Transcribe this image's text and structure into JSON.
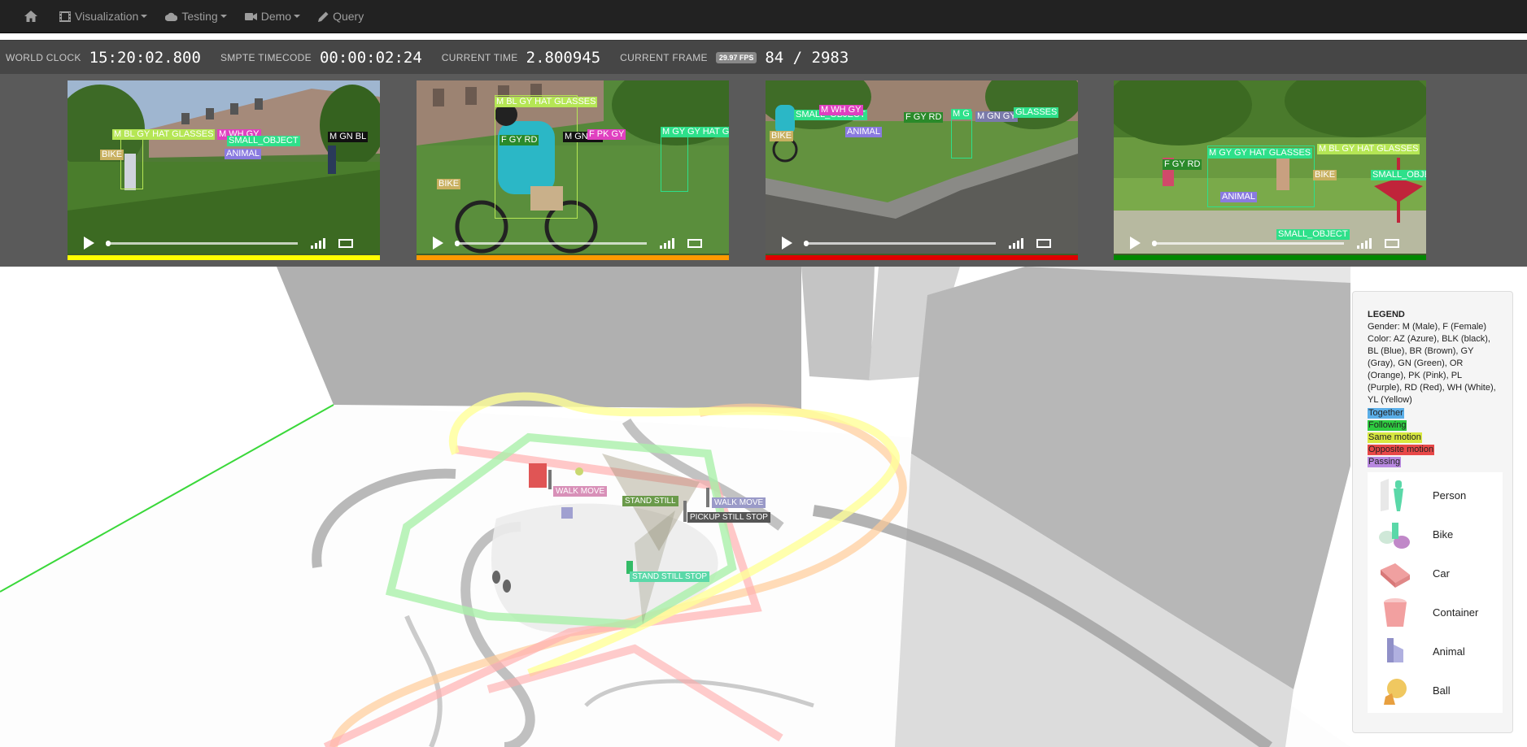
{
  "navbar": {
    "items": [
      {
        "label": "",
        "icon": "home-icon"
      },
      {
        "label": "Visualization",
        "icon": "film-icon",
        "dropdown": true
      },
      {
        "label": "Testing",
        "icon": "cloud-icon",
        "dropdown": true
      },
      {
        "label": "Demo",
        "icon": "video-camera-icon",
        "dropdown": true
      },
      {
        "label": "Query",
        "icon": "pencil-icon",
        "dropdown": false
      }
    ]
  },
  "clock": {
    "world_clock_label": "WORLD CLOCK",
    "world_clock_value": "15:20:02.800",
    "smpte_label": "SMPTE TIMECODE",
    "smpte_value": "00:00:02:24",
    "current_time_label": "CURRENT TIME",
    "current_time_value": "2.800945",
    "current_frame_label": "CURRENT FRAME",
    "fps_badge": "29.97 FPS",
    "current_frame_value": "84 / 2983"
  },
  "videos": [
    {
      "accent": "#ffff00",
      "tags": [
        {
          "text": "M BL GY HAT GLASSES",
          "color": "#b5e655"
        },
        {
          "text": "M WH GY",
          "color": "#e040c0"
        },
        {
          "text": "SMALL_OBJECT",
          "color": "#2ee08a"
        },
        {
          "text": "M GN BL",
          "color": "#111111"
        },
        {
          "text": "BIKE",
          "color": "#c8b060"
        },
        {
          "text": "ANIMAL",
          "color": "#8a7ae0"
        }
      ]
    },
    {
      "accent": "#ff9900",
      "tags": [
        {
          "text": "M BL GY HAT GLASSES",
          "color": "#b5e655"
        },
        {
          "text": "F GY RD",
          "color": "#2a8a2a"
        },
        {
          "text": "M GN BL",
          "color": "#111111"
        },
        {
          "text": "F PK GY",
          "color": "#e040c0"
        },
        {
          "text": "M GY GY HAT GL",
          "color": "#2ee08a"
        },
        {
          "text": "BIKE",
          "color": "#c8b060"
        }
      ]
    },
    {
      "accent": "#e00000",
      "tags": [
        {
          "text": "SMALL_OBJECT",
          "color": "#2ee08a"
        },
        {
          "text": "M WH GY",
          "color": "#e040c0"
        },
        {
          "text": "ANIMAL",
          "color": "#8a7ae0"
        },
        {
          "text": "F GY RD",
          "color": "#2a8a2a"
        },
        {
          "text": "M G",
          "color": "#2ee08a"
        },
        {
          "text": "M GN GY",
          "color": "#7a7aaa"
        },
        {
          "text": "GLASSES",
          "color": "#2ee08a"
        },
        {
          "text": "BIKE",
          "color": "#c8b060"
        }
      ]
    },
    {
      "accent": "#008800",
      "tags": [
        {
          "text": "F GY RD",
          "color": "#2a8a2a"
        },
        {
          "text": "M GY GY HAT GLASSES",
          "color": "#2ee08a"
        },
        {
          "text": "M BL GY HAT GLASSES",
          "color": "#b5e655"
        },
        {
          "text": "BIKE",
          "color": "#c8b060"
        },
        {
          "text": "SMALL_OBJE",
          "color": "#2ee08a"
        },
        {
          "text": "ANIMAL",
          "color": "#8a7ae0"
        },
        {
          "text": "SMALL_OBJECT",
          "color": "#2ee08a"
        }
      ]
    }
  ],
  "scene": {
    "activities": [
      {
        "text": "WALK MOVE",
        "color": "#d890b8"
      },
      {
        "text": "STAND STILL",
        "color": "#6a9a4a"
      },
      {
        "text": "WALK MOVE",
        "color": "#9a9ac8"
      },
      {
        "text": "PICKUP STILL STOP",
        "color": "#555555"
      },
      {
        "text": "STAND STILL STOP",
        "color": "#5ad8a8"
      }
    ]
  },
  "legend": {
    "title": "LEGEND",
    "gender": "Gender: M (Male), F (Female)",
    "color": "Color: AZ (Azure), BLK (black), BL (Blue), BR (Brown), GY (Gray), GN (Green), OR (Orange), PK (Pink), PL (Purple), RD (Red), WH (White), YL (Yellow)",
    "relations": [
      {
        "label": "Together",
        "color": "#5aaee8"
      },
      {
        "label": "Following",
        "color": "#2ecc40"
      },
      {
        "label": "Same motion",
        "color": "#d8e840"
      },
      {
        "label": "Opposite motion",
        "color": "#e84848"
      },
      {
        "label": "Passing",
        "color": "#b888e0"
      }
    ],
    "objects": [
      {
        "label": "Person",
        "icon": "person-icon"
      },
      {
        "label": "Bike",
        "icon": "bike-icon"
      },
      {
        "label": "Car",
        "icon": "car-icon"
      },
      {
        "label": "Container",
        "icon": "container-icon"
      },
      {
        "label": "Animal",
        "icon": "animal-icon"
      },
      {
        "label": "Ball",
        "icon": "ball-icon"
      }
    ]
  }
}
